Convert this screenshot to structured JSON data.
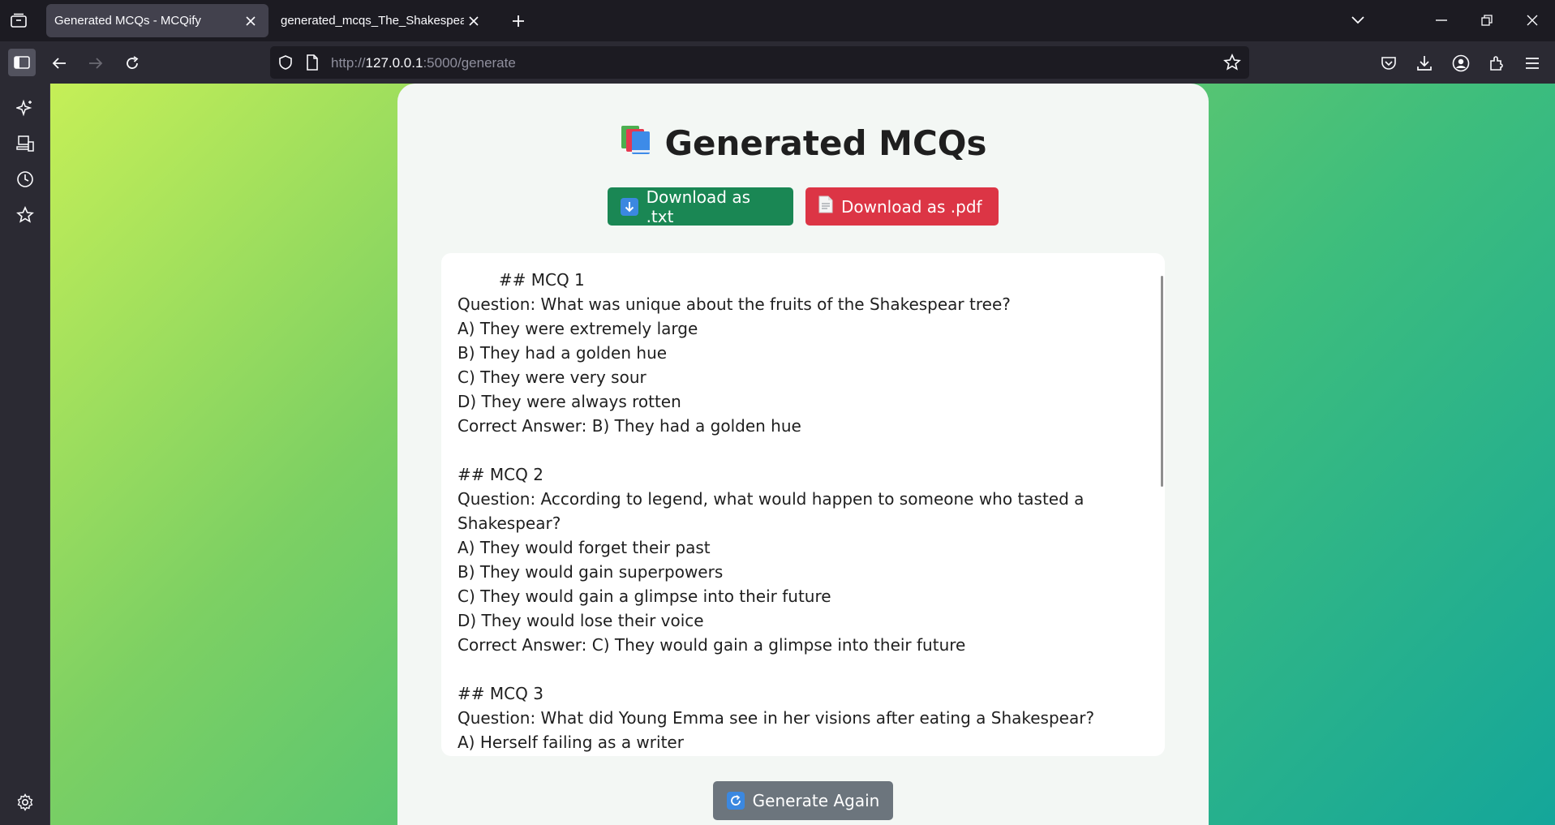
{
  "browser": {
    "tabs": [
      {
        "title": "Generated MCQs - MCQify",
        "active": true
      },
      {
        "title": "generated_mcqs_The_Shakespear_E",
        "active": false
      }
    ],
    "url_prefix": "http://",
    "url_host": "127.0.0.1",
    "url_path": ":5000/generate"
  },
  "page": {
    "title": "Generated MCQs",
    "title_icon": "books-icon",
    "download_txt_label": "Download as .txt",
    "download_pdf_label": "Download as .pdf",
    "generate_again_label": "Generate Again",
    "mcq_text": "        ## MCQ 1\nQuestion: What was unique about the fruits of the Shakespear tree?\nA) They were extremely large\nB) They had a golden hue\nC) They were very sour\nD) They were always rotten\nCorrect Answer: B) They had a golden hue\n\n## MCQ 2\nQuestion: According to legend, what would happen to someone who tasted a Shakespear?\nA) They would forget their past\nB) They would gain superpowers\nC) They would gain a glimpse into their future\nD) They would lose their voice\nCorrect Answer: C) They would gain a glimpse into their future\n\n## MCQ 3\nQuestion: What did Young Emma see in her visions after eating a Shakespear?\nA) Herself failing as a writer"
  },
  "colors": {
    "download_txt": "#1a8754",
    "download_pdf": "#dc3545",
    "generate_again": "#6c757d"
  }
}
